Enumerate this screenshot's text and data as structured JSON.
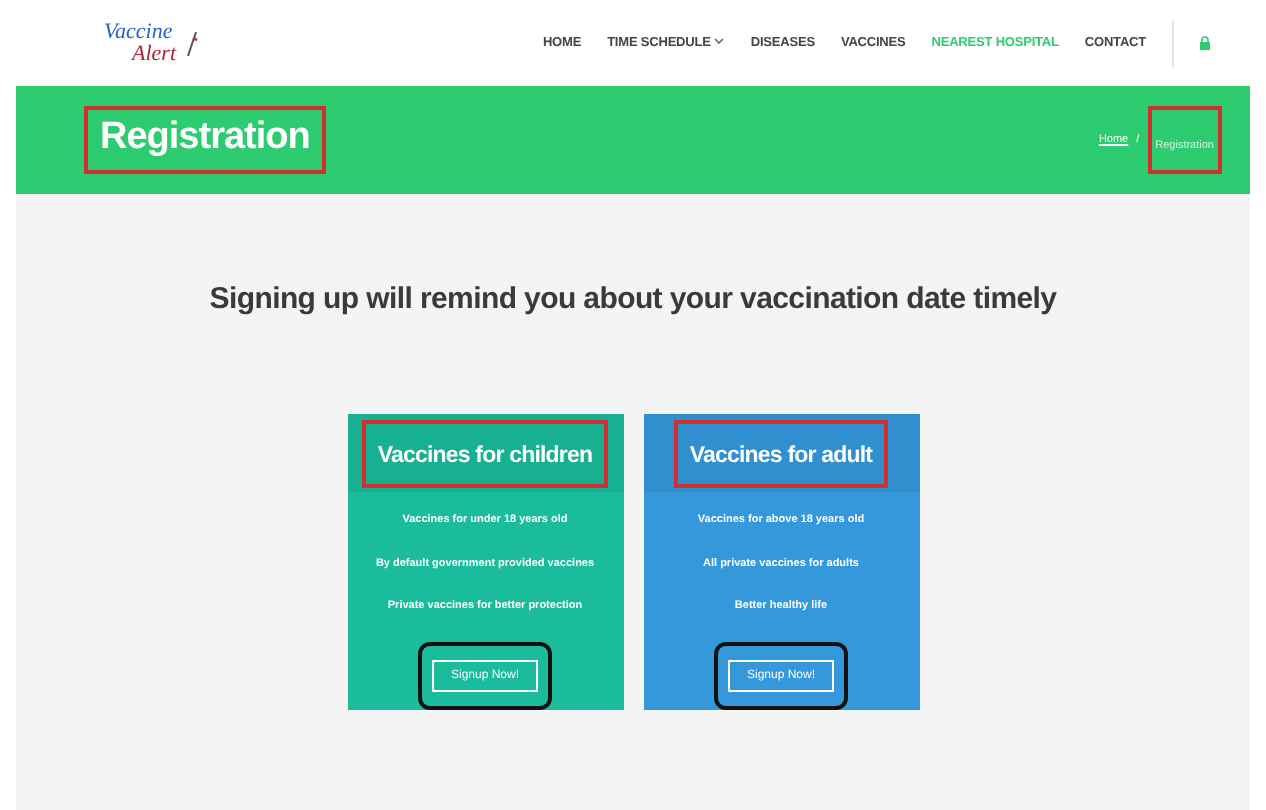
{
  "logo": {
    "line1": "Vaccine",
    "line2": "Alert"
  },
  "nav": [
    {
      "label": "HOME",
      "selected": false
    },
    {
      "label": "TIME SCHEDULE",
      "selected": false,
      "dropdown": true
    },
    {
      "label": "DISEASES",
      "selected": false
    },
    {
      "label": "VACCINES",
      "selected": false
    },
    {
      "label": "NEAREST HOSPITAL",
      "selected": true
    },
    {
      "label": "CONTACT",
      "selected": false
    }
  ],
  "banner": {
    "title": "Registration",
    "title_highlighted": true,
    "breadcrumb": [
      {
        "label": "Home",
        "current": false,
        "highlighted": false
      },
      {
        "label": "Registration",
        "current": true,
        "highlighted": true
      }
    ],
    "separator": "/"
  },
  "heading": "Signing up will remind you about your vaccination date timely",
  "cards": [
    {
      "title": "Vaccines for children",
      "color": "#1abc9c",
      "title_highlighted": true,
      "features": [
        "Vaccines for under 18 years old",
        "By default government provided vaccines",
        "Private vaccines for better protection"
      ],
      "button": "Signup Now!",
      "button_highlighted": true
    },
    {
      "title": "Vaccines for adult",
      "color": "#3498db",
      "title_highlighted": true,
      "features": [
        "Vaccines for above 18 years old",
        "All private vaccines for adults",
        "Better healthy life"
      ],
      "button": "Signup Now!",
      "button_highlighted": true
    }
  ]
}
